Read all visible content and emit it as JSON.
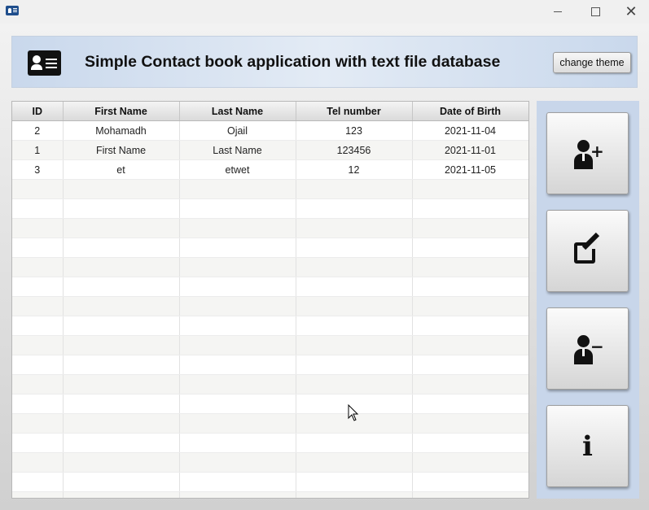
{
  "window": {
    "controls": {
      "minimize": "—",
      "maximize": "☐",
      "close": "✕"
    }
  },
  "header": {
    "title": "Simple Contact book application with text file database",
    "theme_button": "change theme",
    "icon": "contact-card-icon"
  },
  "table": {
    "columns": [
      "ID",
      "First Name",
      "Last Name",
      "Tel number",
      "Date of Birth"
    ],
    "rows": [
      [
        "2",
        "Mohamadh",
        "Ojail",
        "123",
        "2021-11-04"
      ],
      [
        "1",
        "First Name",
        "Last Name",
        "123456",
        "2021-11-01"
      ],
      [
        "3",
        "et",
        "etwet",
        "12",
        "2021-11-05"
      ]
    ]
  },
  "actions": [
    {
      "name": "add-contact-button",
      "icon": "add-user-icon"
    },
    {
      "name": "edit-contact-button",
      "icon": "edit-icon"
    },
    {
      "name": "remove-contact-button",
      "icon": "remove-user-icon"
    },
    {
      "name": "info-button",
      "icon": "info-icon",
      "label": "i"
    }
  ],
  "colors": {
    "header_bg": "#d6e2f1",
    "side_panel_bg": "#c8d6ea",
    "window_bg": "#d2d2d2"
  }
}
